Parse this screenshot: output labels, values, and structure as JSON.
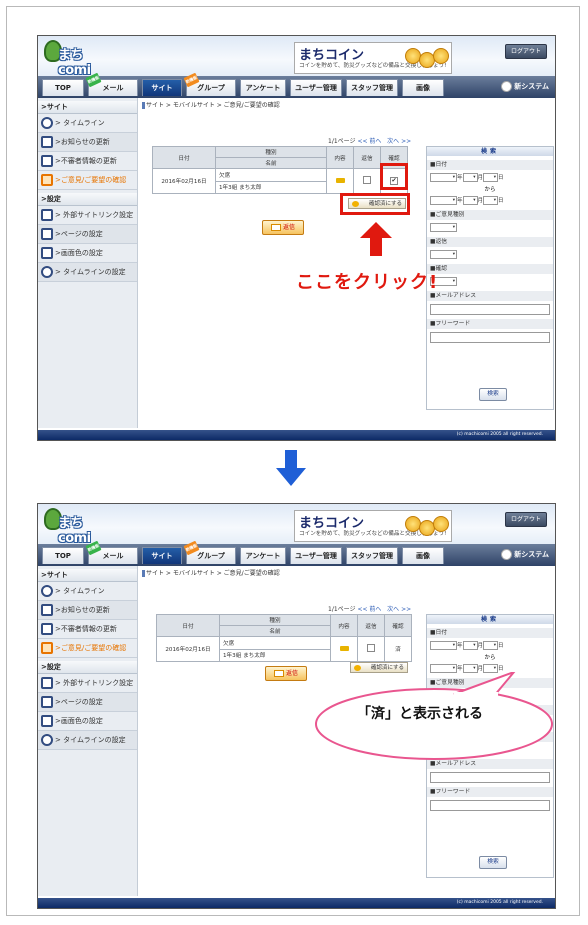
{
  "app": {
    "logo": "まちcomi",
    "banner_title": "まちコイン",
    "banner_sub": "コインを貯めて、防災グッズなどの備品と交換しましょう!",
    "logout": "ログアウト",
    "new_system": "新システム",
    "copyright": "(c) machicomi 2005 all right reserved.",
    "tabs": [
      "TOP",
      "メール",
      "サイト",
      "グループ",
      "アンケート",
      "ユーザー管理",
      "スタッフ管理",
      "画像"
    ],
    "new_badge": "新機能"
  },
  "sidebar": {
    "site_header": "サイト",
    "site_items": [
      "タイムライン",
      "お知らせの更新",
      "不審者情報の更新",
      "ご意見/ご要望の確認"
    ],
    "settings_header": "設定",
    "settings_items": [
      "外部サイトリンク設定",
      "ページの設定",
      "画面色の設定",
      "タイムラインの設定"
    ]
  },
  "main": {
    "breadcrumb": "サイト > モバイルサイト > ご意見/ご要望の確認",
    "pager": "1/1ページ",
    "prev": "<< 前へ",
    "next": "次へ >>",
    "columns": {
      "date": "日付",
      "type": "種別",
      "name": "名前",
      "content": "内容",
      "reply": "返信",
      "confirm": "確認"
    },
    "row": {
      "date": "2016年02月16日",
      "type": "欠席",
      "name": "1年3組 まち太郎",
      "confirmed_mark": "済"
    },
    "confirm_button": "確認済にする",
    "reply_button": "返信"
  },
  "search": {
    "title": "検索",
    "date_label": "日付",
    "year": "年",
    "month": "月",
    "day": "日",
    "from": "から",
    "type_label": "ご意見種別",
    "reply_label": "返信",
    "confirm_label": "確認",
    "email_label": "メールアドレス",
    "freeword_label": "フリーワード",
    "select_default": "-",
    "button": "検索"
  },
  "annotations": {
    "click_here": "ここをクリック!",
    "result": "「済」と表示される"
  },
  "colors": {
    "annotation_red": "#e0190f",
    "bubble_pink": "#e9568f",
    "arrow_blue": "#1f5fd6"
  }
}
